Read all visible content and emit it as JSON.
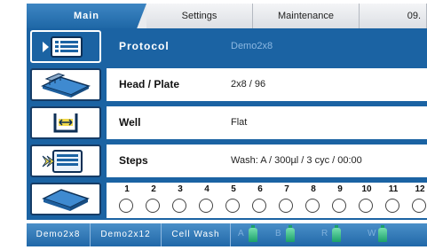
{
  "tabs": [
    {
      "label": "Main",
      "active": true
    },
    {
      "label": "Settings",
      "active": false
    },
    {
      "label": "Maintenance",
      "active": false
    },
    {
      "label": "09.",
      "active": false
    }
  ],
  "rows": {
    "protocol": {
      "label": "Protocol",
      "value": "Demo2x8",
      "icon": "protocol-list-icon"
    },
    "head": {
      "label": "Head / Plate",
      "value": "2x8 / 96",
      "icon": "head-plate-icon"
    },
    "well": {
      "label": "Well",
      "value": "Flat",
      "icon": "well-shape-icon"
    },
    "steps": {
      "label": "Steps",
      "value": "Wash: A / 300µl / 3 cyc / 00:00",
      "icon": "steps-list-icon"
    }
  },
  "stack": {
    "icon": "plate-stack-icon",
    "numbers": [
      "1",
      "2",
      "3",
      "4",
      "5",
      "6",
      "7",
      "8",
      "9",
      "10",
      "11",
      "12"
    ]
  },
  "bottom_bar": {
    "buttons": [
      "Demo2x8",
      "Demo2x12",
      "Cell Wash"
    ],
    "bottles": [
      "A",
      "B",
      "R",
      "W"
    ]
  },
  "colors": {
    "accent": "#1b63a3",
    "tab_active": "#2f7bbb",
    "bottle": "#2db97e"
  }
}
